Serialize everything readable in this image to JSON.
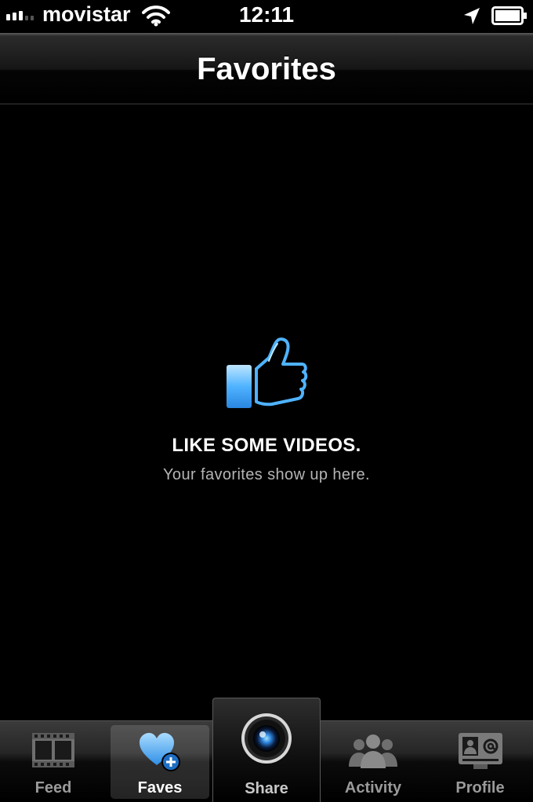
{
  "status_bar": {
    "carrier": "movistar",
    "time": "12:11",
    "icons": [
      "signal-icon",
      "wifi-icon",
      "location-arrow-icon",
      "battery-icon"
    ]
  },
  "nav": {
    "title": "Favorites"
  },
  "empty_state": {
    "icon": "thumbs-up-icon",
    "title": "LIKE SOME VIDEOS.",
    "subtitle": "Your favorites show up here."
  },
  "tabs": [
    {
      "label": "Feed",
      "icon": "film-strip-icon",
      "selected": false
    },
    {
      "label": "Faves",
      "icon": "heart-plus-icon",
      "selected": true
    },
    {
      "label": "Share",
      "icon": "camera-lens-icon",
      "selected": false
    },
    {
      "label": "Activity",
      "icon": "people-icon",
      "selected": false
    },
    {
      "label": "Profile",
      "icon": "contact-card-icon",
      "selected": false
    }
  ],
  "colors": {
    "accent_blue": "#4fb3ff",
    "background": "#000000"
  }
}
